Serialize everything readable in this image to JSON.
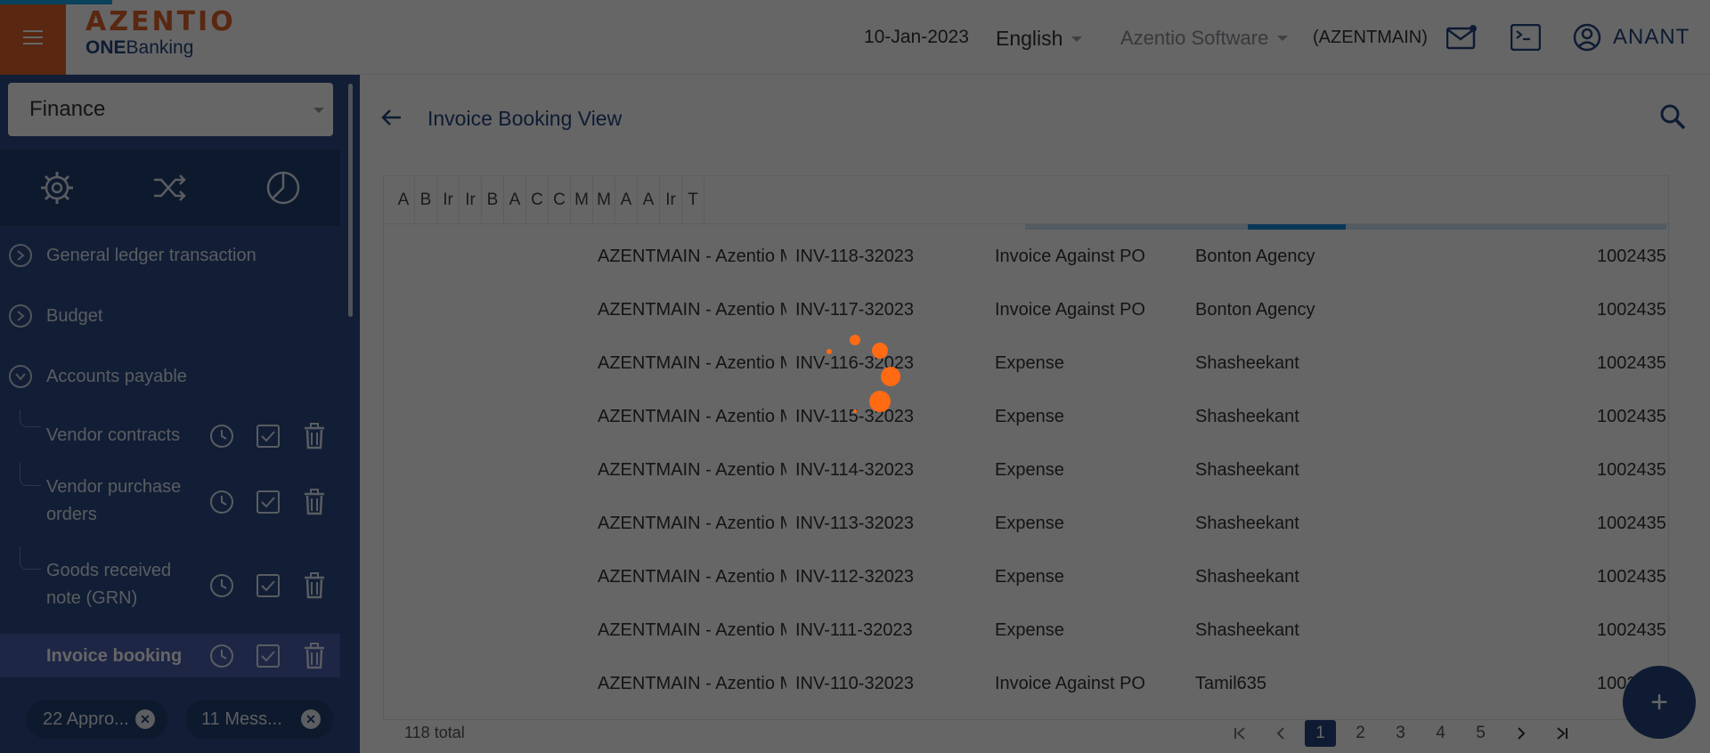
{
  "header": {
    "logo_main": "AZENTIO",
    "logo_sub_bold": "ONE",
    "logo_sub_rest": "Banking",
    "date": "10-Jan-2023",
    "language": "English",
    "company": "Azentio Software",
    "company_code": "(AZENTMAIN)",
    "user": "ANANT"
  },
  "sidebar": {
    "module": "Finance",
    "groups": [
      {
        "label": "General ledger transaction"
      },
      {
        "label": "Budget"
      },
      {
        "label": "Accounts payable"
      }
    ],
    "sub_items": [
      {
        "label": "Vendor contracts"
      },
      {
        "label": "Vendor purchase orders"
      },
      {
        "label": "Goods received note (GRN)"
      },
      {
        "label": "Invoice booking"
      }
    ],
    "chips": [
      {
        "label": "22 Appro..."
      },
      {
        "label": "11 Mess..."
      }
    ]
  },
  "main": {
    "title": "Invoice Booking View",
    "column_headers": [
      "A",
      "B",
      "Ir",
      "Ir",
      "B",
      "A",
      "C",
      "C",
      "M",
      "M",
      "A",
      "A",
      "Ir",
      "T"
    ],
    "rows": [
      {
        "company": "AZENTMAIN - Azentio M",
        "invoice": "INV-118-32023",
        "type": "Invoice Against PO",
        "vendor": "Bonton Agency",
        "code": "1002435"
      },
      {
        "company": "AZENTMAIN - Azentio M",
        "invoice": "INV-117-32023",
        "type": "Invoice Against PO",
        "vendor": "Bonton Agency",
        "code": "1002435"
      },
      {
        "company": "AZENTMAIN - Azentio M",
        "invoice": "INV-116-32023",
        "type": "Expense",
        "vendor": "Shasheekant",
        "code": "1002435"
      },
      {
        "company": "AZENTMAIN - Azentio M",
        "invoice": "INV-115-32023",
        "type": "Expense",
        "vendor": "Shasheekant",
        "code": "1002435"
      },
      {
        "company": "AZENTMAIN - Azentio M",
        "invoice": "INV-114-32023",
        "type": "Expense",
        "vendor": "Shasheekant",
        "code": "1002435"
      },
      {
        "company": "AZENTMAIN - Azentio M",
        "invoice": "INV-113-32023",
        "type": "Expense",
        "vendor": "Shasheekant",
        "code": "1002435"
      },
      {
        "company": "AZENTMAIN - Azentio M",
        "invoice": "INV-112-32023",
        "type": "Expense",
        "vendor": "Shasheekant",
        "code": "1002435"
      },
      {
        "company": "AZENTMAIN - Azentio M",
        "invoice": "INV-111-32023",
        "type": "Expense",
        "vendor": "Shasheekant",
        "code": "1002435"
      },
      {
        "company": "AZENTMAIN - Azentio M",
        "invoice": "INV-110-32023",
        "type": "Invoice Against PO",
        "vendor": "Tamil635",
        "code": "1002435"
      }
    ],
    "total": "118 total",
    "pages": [
      "1",
      "2",
      "3",
      "4",
      "5"
    ],
    "current_page": "1",
    "fab_label": "+"
  },
  "colors": {
    "brand_orange": "#e0632a",
    "brand_navy": "#24447e",
    "sidebar_bg": "#2b4c85",
    "active_item": "#4d5fb0",
    "spinner": "#ff6a13"
  },
  "icons": [
    "menu-icon",
    "mail-icon",
    "terminal-icon",
    "user-icon",
    "gear-icon",
    "shuffle-icon",
    "pie-chart-icon",
    "chevron-right-icon",
    "chevron-down-icon",
    "history-icon",
    "check-icon",
    "trash-icon",
    "close-icon",
    "back-arrow-icon",
    "search-icon",
    "first-page-icon",
    "prev-page-icon",
    "next-page-icon",
    "last-page-icon",
    "plus-icon"
  ]
}
